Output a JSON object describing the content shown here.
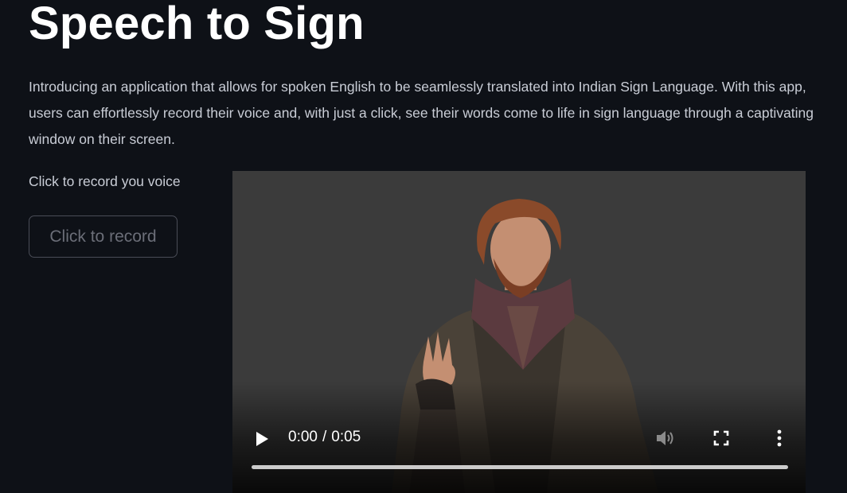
{
  "app": {
    "title": "Speech to Sign",
    "intro": "Introducing an application that allows for spoken English to be seamlessly translated into Indian Sign Language. With this app, users can effortlessly record their voice and, with just a click, see their words come to life in sign language through a captivating window on their screen."
  },
  "recorder": {
    "label": "Click to record you voice",
    "button_label": "Click to record"
  },
  "video": {
    "current_time": "0:00",
    "separator": "/",
    "duration": "0:05",
    "progress_fraction": 0,
    "icons": {
      "play": "play-icon",
      "volume": "volume-icon",
      "fullscreen": "fullscreen-icon",
      "more": "more-options-icon"
    }
  },
  "colors": {
    "background": "#0e1117",
    "video_background": "#3b3b3b",
    "text_primary": "#ffffff",
    "text_body": "#c9cdd6",
    "button_border": "#4a4d57"
  }
}
